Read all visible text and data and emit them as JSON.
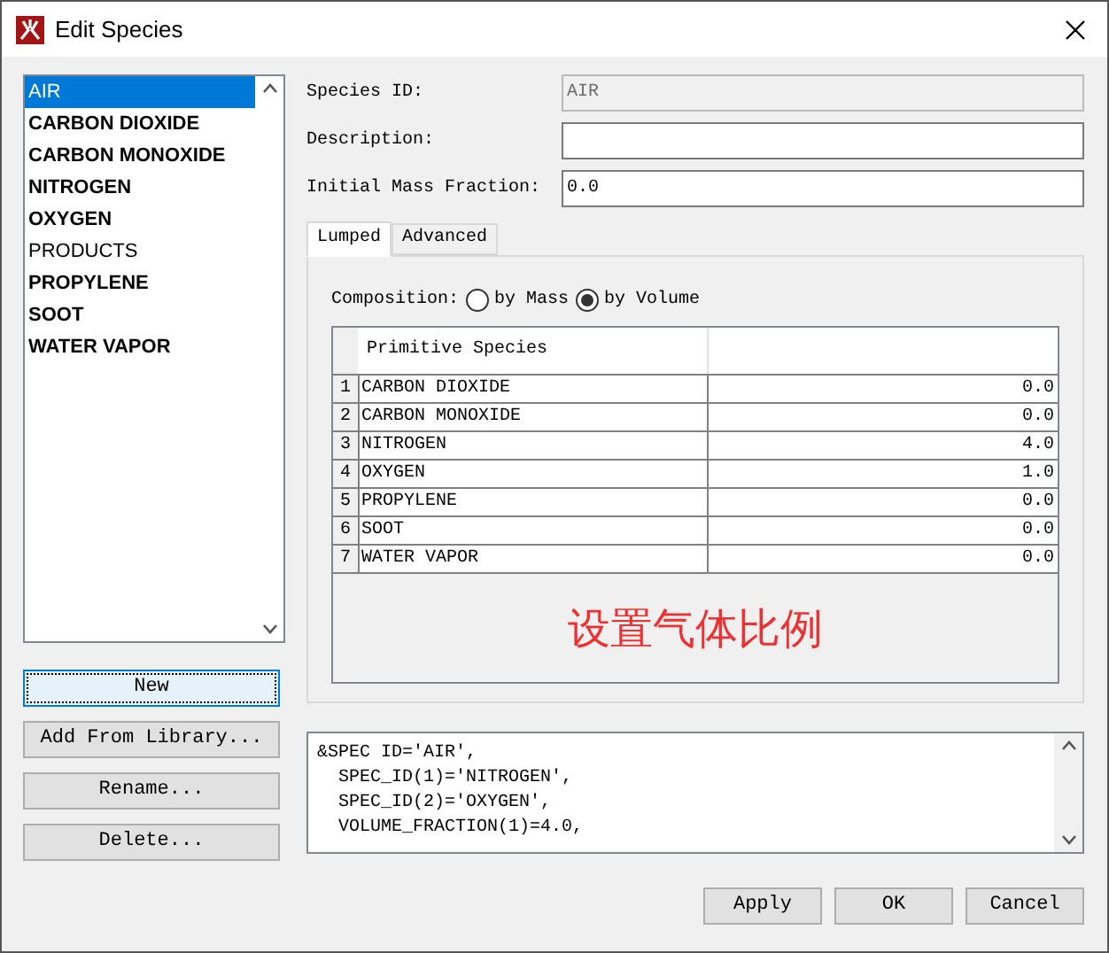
{
  "window": {
    "title": "Edit Species"
  },
  "species_list": [
    {
      "label": "AIR",
      "bold": false,
      "selected": true
    },
    {
      "label": "CARBON DIOXIDE",
      "bold": true,
      "selected": false
    },
    {
      "label": "CARBON MONOXIDE",
      "bold": true,
      "selected": false
    },
    {
      "label": "NITROGEN",
      "bold": true,
      "selected": false
    },
    {
      "label": "OXYGEN",
      "bold": true,
      "selected": false
    },
    {
      "label": "PRODUCTS",
      "bold": false,
      "selected": false
    },
    {
      "label": "PROPYLENE",
      "bold": true,
      "selected": false
    },
    {
      "label": "SOOT",
      "bold": true,
      "selected": false
    },
    {
      "label": "WATER VAPOR",
      "bold": true,
      "selected": false
    }
  ],
  "side_buttons": [
    {
      "label": "New",
      "focused": true
    },
    {
      "label": "Add From Library...",
      "focused": false
    },
    {
      "label": "Rename...",
      "focused": false
    },
    {
      "label": "Delete...",
      "focused": false
    }
  ],
  "fields": [
    {
      "label": "Species ID:",
      "value": "AIR",
      "disabled": true
    },
    {
      "label": "Description:",
      "disabled": false
    },
    {
      "label": "Initial Mass Fraction:",
      "value": "0.0",
      "disabled": false
    }
  ],
  "tabs": [
    {
      "label": "Lumped",
      "selected": true
    },
    {
      "label": "Advanced",
      "selected": false
    }
  ],
  "composition": {
    "label": "Composition:",
    "options": [
      {
        "label": "by Mass",
        "selected": false
      },
      {
        "label": "by Volume",
        "selected": true
      }
    ]
  },
  "table": {
    "columns": [
      "Primitive Species"
    ],
    "rows": [
      {
        "index": "1",
        "species": "CARBON DIOXIDE",
        "value": "0.0"
      },
      {
        "index": "2",
        "species": "CARBON MONOXIDE",
        "value": "0.0"
      },
      {
        "index": "3",
        "species": "NITROGEN",
        "value": "4.0"
      },
      {
        "index": "4",
        "species": "OXYGEN",
        "value": "1.0"
      },
      {
        "index": "5",
        "species": "PROPYLENE",
        "value": "0.0"
      },
      {
        "index": "6",
        "species": "SOOT",
        "value": "0.0"
      },
      {
        "index": "7",
        "species": "WATER VAPOR",
        "value": "0.0"
      }
    ]
  },
  "annotation": "设置气体比例",
  "code_lines": [
    "&SPEC ID='AIR',",
    "  SPEC_ID(1)='NITROGEN',",
    "  SPEC_ID(2)='OXYGEN',",
    "  VOLUME_FRACTION(1)=4.0,"
  ],
  "buttons": [
    "Apply",
    "OK",
    "Cancel"
  ]
}
